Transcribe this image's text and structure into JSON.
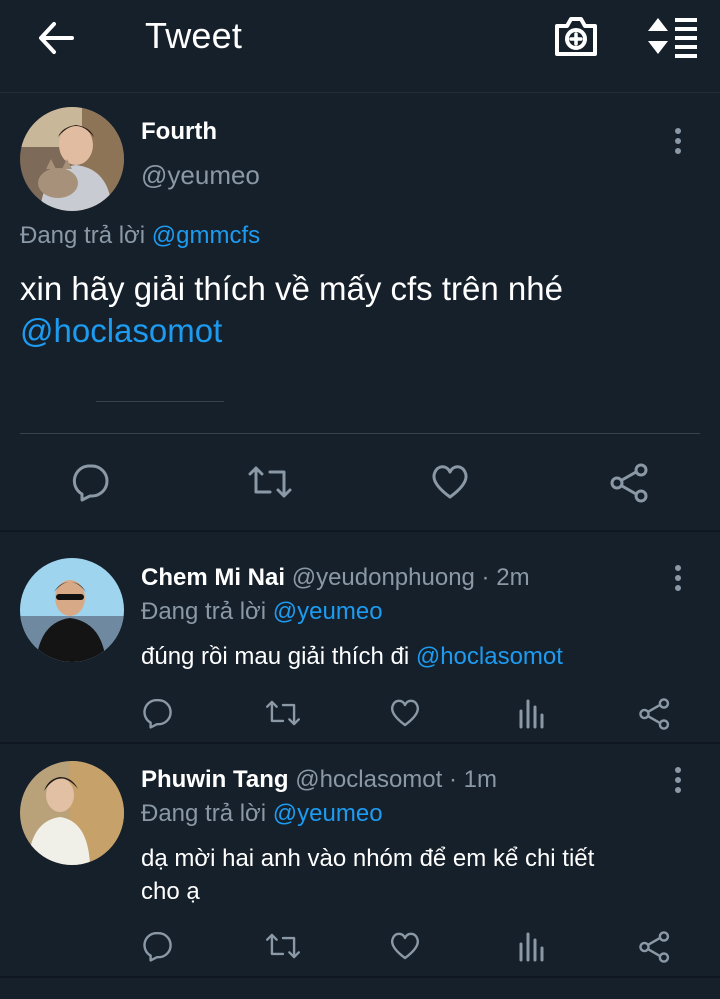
{
  "header": {
    "title": "Tweet",
    "back_icon": "arrow-left-icon",
    "camera_icon": "camera-add-icon",
    "sort_icon": "sort-icon"
  },
  "main_tweet": {
    "name": "Fourth",
    "handle": "@yeumeo",
    "replying_prefix": "Đang trả lời",
    "replying_to": "@gmmcfs",
    "text": "xin hãy giải thích về mấy cfs trên nhé",
    "mention": "@hoclasomot",
    "actions": [
      "reply-icon",
      "retweet-icon",
      "like-icon",
      "share-icon"
    ]
  },
  "replies": [
    {
      "name": "Chem Mi Nai",
      "meta": "@yeudonphuong · 2m",
      "replying_prefix": "Đang trả lời",
      "replying_to": "@yeumeo",
      "text": "đúng rồi mau giải thích đi",
      "mention": "@hoclasomot"
    },
    {
      "name": "Phuwin Tang",
      "meta": "@hoclasomot · 1m",
      "replying_prefix": "Đang trả lời",
      "replying_to": "@yeumeo",
      "text_line1": "dạ mời hai anh vào nhóm để em kể chi tiết",
      "text_line2": "cho ạ"
    }
  ],
  "colors": {
    "background": "#15202b",
    "accent": "#1d9bf0",
    "muted": "#8b98a5",
    "divider": "#38444d"
  }
}
